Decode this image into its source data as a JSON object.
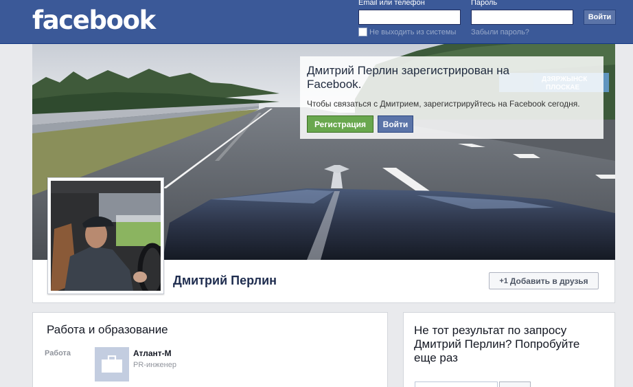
{
  "header": {
    "logo": "facebook",
    "email_label": "Email или телефон",
    "email_value": "",
    "password_label": "Пароль",
    "password_value": "",
    "login_button": "Войти",
    "keep_logged_in": "Не выходить из системы",
    "keep_logged_in_checked": false,
    "forgot_password": "Забыли пароль?"
  },
  "cover": {
    "sign_text": "ДЗЯРЖЫНСК ПЛОСКАЕ",
    "card": {
      "title": "Дмитрий Перлин зарегистрирован на Facebook.",
      "subtitle": "Чтобы связаться с Дмитрием, зарегистрируйтесь на Facebook сегодня.",
      "register_button": "Регистрация",
      "login_button": "Войти"
    }
  },
  "profile": {
    "name": "Дмитрий Перлин",
    "add_friend": "Добавить в друзья"
  },
  "work": {
    "title": "Работа и образование",
    "label": "Работа",
    "employer": "Атлант-М",
    "position": "PR-инженер"
  },
  "search_box": {
    "title": "Не тот результат по запросу Дмитрий Перлин? Попробуйте еще раз",
    "input_value": "",
    "button": ""
  },
  "colors": {
    "brand": "#3b5998",
    "register_green": "#69a74e",
    "page_background": "#e9eaed"
  }
}
